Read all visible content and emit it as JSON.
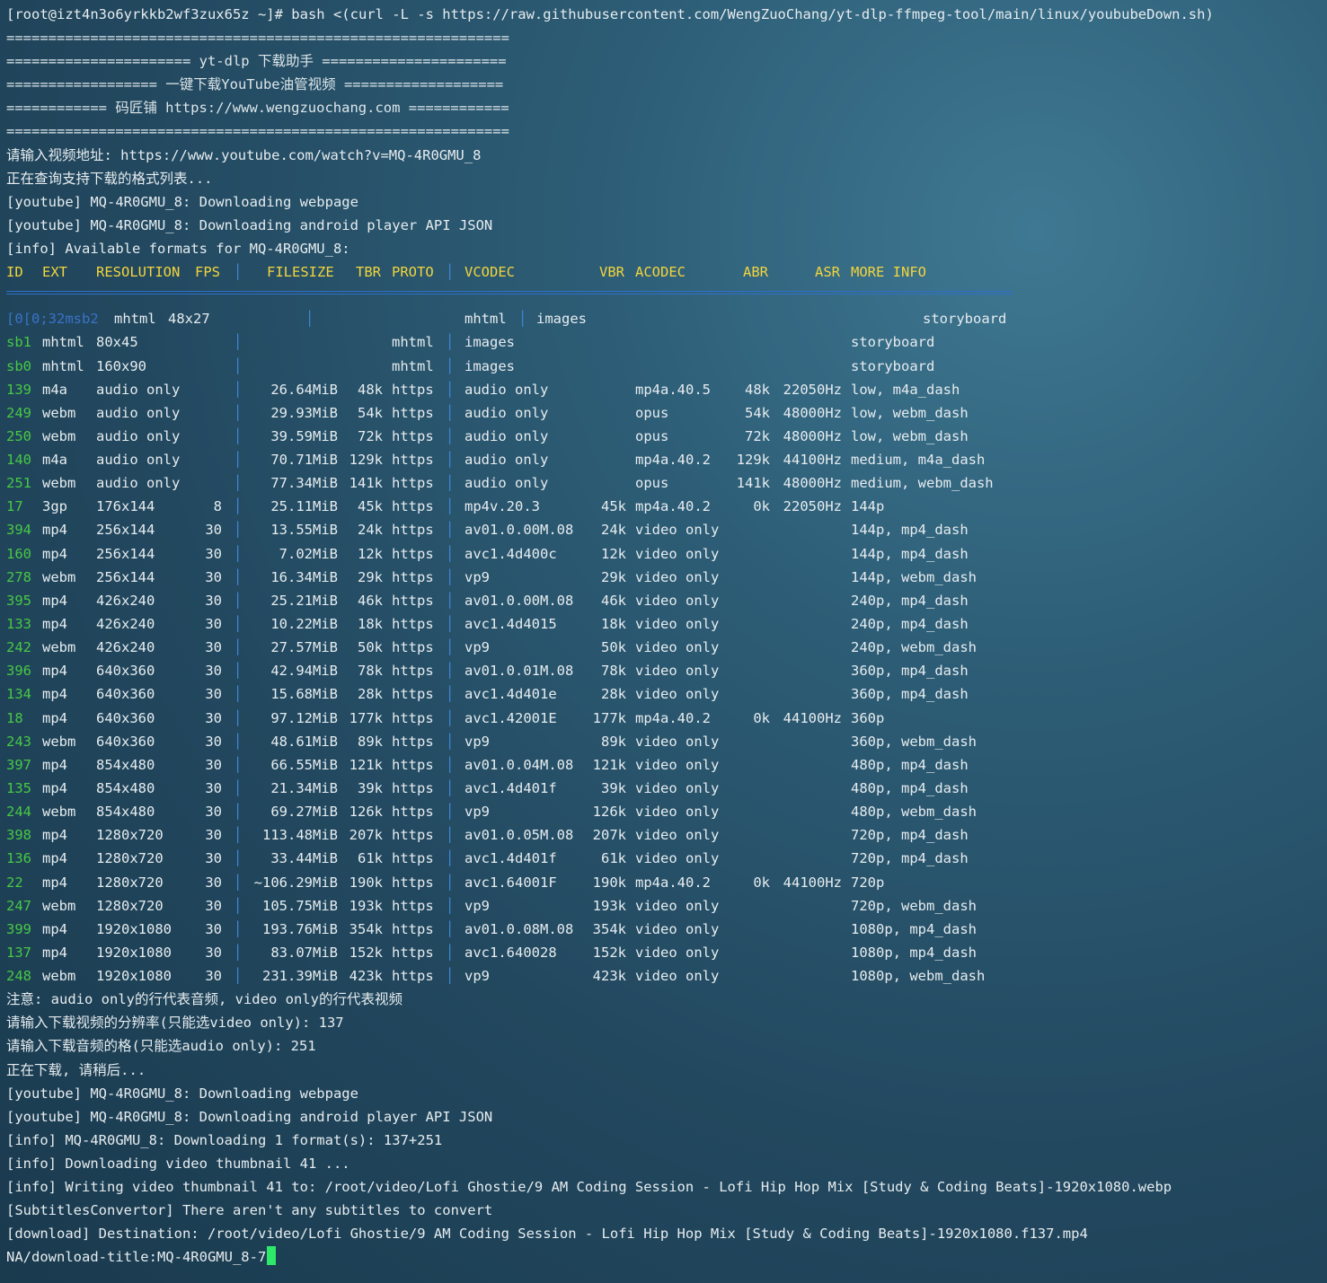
{
  "command": {
    "prompt": "[root@izt4n3o6yrkkb2wf3zux65z ~]#",
    "text": "bash <(curl -L -s https://raw.githubusercontent.com/WengZuoChang/yt-dlp-ffmpeg-tool/main/linux/yoububeDown.sh)"
  },
  "banner": [
    "============================================================",
    "====================== yt-dlp 下载助手 ======================",
    "================== 一键下载YouTube油管视频 ===================",
    "============ 码匠铺 https://www.wengzuochang.com ============",
    "============================================================"
  ],
  "pre_lines": [
    "请输入视频地址: https://www.youtube.com/watch?v=MQ-4R0GMU_8",
    "正在查询支持下载的格式列表...",
    "[youtube] MQ-4R0GMU_8: Downloading webpage",
    "[youtube] MQ-4R0GMU_8: Downloading android player API JSON",
    "[info] Available formats for MQ-4R0GMU_8:"
  ],
  "table_header": {
    "id": "ID",
    "ext": "EXT",
    "resolution": "RESOLUTION",
    "fps": "FPS",
    "filesize": "FILESIZE",
    "tbr": "TBR",
    "proto": "PROTO",
    "vcodec": "VCODEC",
    "vbr": "VBR",
    "acodec": "ACODEC",
    "abr": "ABR",
    "asr": "ASR",
    "more": "MORE INFO"
  },
  "first_row": {
    "id": "[0[0;32msb2",
    "ext": "mhtml",
    "resolution": "48x27",
    "vcodec": "mhtml",
    "acodec": "images",
    "more": "storyboard"
  },
  "formats": [
    {
      "id": "sb1",
      "ext": "mhtml",
      "res": "80x45",
      "fps": "",
      "size": "",
      "tbr": "",
      "proto": "mhtml",
      "vcodec": "images",
      "vbr": "",
      "acodec": "",
      "abr": "",
      "asr": "",
      "more": "storyboard"
    },
    {
      "id": "sb0",
      "ext": "mhtml",
      "res": "160x90",
      "fps": "",
      "size": "",
      "tbr": "",
      "proto": "mhtml",
      "vcodec": "images",
      "vbr": "",
      "acodec": "",
      "abr": "",
      "asr": "",
      "more": "storyboard"
    },
    {
      "id": "139",
      "ext": "m4a",
      "res": "audio only",
      "fps": "",
      "size": "26.64MiB",
      "tbr": "48k",
      "proto": "https",
      "vcodec": "audio only",
      "vbr": "",
      "acodec": "mp4a.40.5",
      "abr": "48k",
      "asr": "22050Hz",
      "more": "low, m4a_dash"
    },
    {
      "id": "249",
      "ext": "webm",
      "res": "audio only",
      "fps": "",
      "size": "29.93MiB",
      "tbr": "54k",
      "proto": "https",
      "vcodec": "audio only",
      "vbr": "",
      "acodec": "opus",
      "abr": "54k",
      "asr": "48000Hz",
      "more": "low, webm_dash"
    },
    {
      "id": "250",
      "ext": "webm",
      "res": "audio only",
      "fps": "",
      "size": "39.59MiB",
      "tbr": "72k",
      "proto": "https",
      "vcodec": "audio only",
      "vbr": "",
      "acodec": "opus",
      "abr": "72k",
      "asr": "48000Hz",
      "more": "low, webm_dash"
    },
    {
      "id": "140",
      "ext": "m4a",
      "res": "audio only",
      "fps": "",
      "size": "70.71MiB",
      "tbr": "129k",
      "proto": "https",
      "vcodec": "audio only",
      "vbr": "",
      "acodec": "mp4a.40.2",
      "abr": "129k",
      "asr": "44100Hz",
      "more": "medium, m4a_dash"
    },
    {
      "id": "251",
      "ext": "webm",
      "res": "audio only",
      "fps": "",
      "size": "77.34MiB",
      "tbr": "141k",
      "proto": "https",
      "vcodec": "audio only",
      "vbr": "",
      "acodec": "opus",
      "abr": "141k",
      "asr": "48000Hz",
      "more": "medium, webm_dash"
    },
    {
      "id": "17",
      "ext": "3gp",
      "res": "176x144",
      "fps": "8",
      "size": "25.11MiB",
      "tbr": "45k",
      "proto": "https",
      "vcodec": "mp4v.20.3",
      "vbr": "45k",
      "acodec": "mp4a.40.2",
      "abr": "0k",
      "asr": "22050Hz",
      "more": "144p"
    },
    {
      "id": "394",
      "ext": "mp4",
      "res": "256x144",
      "fps": "30",
      "size": "13.55MiB",
      "tbr": "24k",
      "proto": "https",
      "vcodec": "av01.0.00M.08",
      "vbr": "24k",
      "acodec": "video only",
      "abr": "",
      "asr": "",
      "more": "144p, mp4_dash"
    },
    {
      "id": "160",
      "ext": "mp4",
      "res": "256x144",
      "fps": "30",
      "size": "7.02MiB",
      "tbr": "12k",
      "proto": "https",
      "vcodec": "avc1.4d400c",
      "vbr": "12k",
      "acodec": "video only",
      "abr": "",
      "asr": "",
      "more": "144p, mp4_dash"
    },
    {
      "id": "278",
      "ext": "webm",
      "res": "256x144",
      "fps": "30",
      "size": "16.34MiB",
      "tbr": "29k",
      "proto": "https",
      "vcodec": "vp9",
      "vbr": "29k",
      "acodec": "video only",
      "abr": "",
      "asr": "",
      "more": "144p, webm_dash"
    },
    {
      "id": "395",
      "ext": "mp4",
      "res": "426x240",
      "fps": "30",
      "size": "25.21MiB",
      "tbr": "46k",
      "proto": "https",
      "vcodec": "av01.0.00M.08",
      "vbr": "46k",
      "acodec": "video only",
      "abr": "",
      "asr": "",
      "more": "240p, mp4_dash"
    },
    {
      "id": "133",
      "ext": "mp4",
      "res": "426x240",
      "fps": "30",
      "size": "10.22MiB",
      "tbr": "18k",
      "proto": "https",
      "vcodec": "avc1.4d4015",
      "vbr": "18k",
      "acodec": "video only",
      "abr": "",
      "asr": "",
      "more": "240p, mp4_dash"
    },
    {
      "id": "242",
      "ext": "webm",
      "res": "426x240",
      "fps": "30",
      "size": "27.57MiB",
      "tbr": "50k",
      "proto": "https",
      "vcodec": "vp9",
      "vbr": "50k",
      "acodec": "video only",
      "abr": "",
      "asr": "",
      "more": "240p, webm_dash"
    },
    {
      "id": "396",
      "ext": "mp4",
      "res": "640x360",
      "fps": "30",
      "size": "42.94MiB",
      "tbr": "78k",
      "proto": "https",
      "vcodec": "av01.0.01M.08",
      "vbr": "78k",
      "acodec": "video only",
      "abr": "",
      "asr": "",
      "more": "360p, mp4_dash"
    },
    {
      "id": "134",
      "ext": "mp4",
      "res": "640x360",
      "fps": "30",
      "size": "15.68MiB",
      "tbr": "28k",
      "proto": "https",
      "vcodec": "avc1.4d401e",
      "vbr": "28k",
      "acodec": "video only",
      "abr": "",
      "asr": "",
      "more": "360p, mp4_dash"
    },
    {
      "id": "18",
      "ext": "mp4",
      "res": "640x360",
      "fps": "30",
      "size": "97.12MiB",
      "tbr": "177k",
      "proto": "https",
      "vcodec": "avc1.42001E",
      "vbr": "177k",
      "acodec": "mp4a.40.2",
      "abr": "0k",
      "asr": "44100Hz",
      "more": "360p"
    },
    {
      "id": "243",
      "ext": "webm",
      "res": "640x360",
      "fps": "30",
      "size": "48.61MiB",
      "tbr": "89k",
      "proto": "https",
      "vcodec": "vp9",
      "vbr": "89k",
      "acodec": "video only",
      "abr": "",
      "asr": "",
      "more": "360p, webm_dash"
    },
    {
      "id": "397",
      "ext": "mp4",
      "res": "854x480",
      "fps": "30",
      "size": "66.55MiB",
      "tbr": "121k",
      "proto": "https",
      "vcodec": "av01.0.04M.08",
      "vbr": "121k",
      "acodec": "video only",
      "abr": "",
      "asr": "",
      "more": "480p, mp4_dash"
    },
    {
      "id": "135",
      "ext": "mp4",
      "res": "854x480",
      "fps": "30",
      "size": "21.34MiB",
      "tbr": "39k",
      "proto": "https",
      "vcodec": "avc1.4d401f",
      "vbr": "39k",
      "acodec": "video only",
      "abr": "",
      "asr": "",
      "more": "480p, mp4_dash"
    },
    {
      "id": "244",
      "ext": "webm",
      "res": "854x480",
      "fps": "30",
      "size": "69.27MiB",
      "tbr": "126k",
      "proto": "https",
      "vcodec": "vp9",
      "vbr": "126k",
      "acodec": "video only",
      "abr": "",
      "asr": "",
      "more": "480p, webm_dash"
    },
    {
      "id": "398",
      "ext": "mp4",
      "res": "1280x720",
      "fps": "30",
      "size": "113.48MiB",
      "tbr": "207k",
      "proto": "https",
      "vcodec": "av01.0.05M.08",
      "vbr": "207k",
      "acodec": "video only",
      "abr": "",
      "asr": "",
      "more": "720p, mp4_dash"
    },
    {
      "id": "136",
      "ext": "mp4",
      "res": "1280x720",
      "fps": "30",
      "size": "33.44MiB",
      "tbr": "61k",
      "proto": "https",
      "vcodec": "avc1.4d401f",
      "vbr": "61k",
      "acodec": "video only",
      "abr": "",
      "asr": "",
      "more": "720p, mp4_dash"
    },
    {
      "id": "22",
      "ext": "mp4",
      "res": "1280x720",
      "fps": "30",
      "size": "~106.29MiB",
      "tbr": "190k",
      "proto": "https",
      "vcodec": "avc1.64001F",
      "vbr": "190k",
      "acodec": "mp4a.40.2",
      "abr": "0k",
      "asr": "44100Hz",
      "more": "720p"
    },
    {
      "id": "247",
      "ext": "webm",
      "res": "1280x720",
      "fps": "30",
      "size": "105.75MiB",
      "tbr": "193k",
      "proto": "https",
      "vcodec": "vp9",
      "vbr": "193k",
      "acodec": "video only",
      "abr": "",
      "asr": "",
      "more": "720p, webm_dash"
    },
    {
      "id": "399",
      "ext": "mp4",
      "res": "1920x1080",
      "fps": "30",
      "size": "193.76MiB",
      "tbr": "354k",
      "proto": "https",
      "vcodec": "av01.0.08M.08",
      "vbr": "354k",
      "acodec": "video only",
      "abr": "",
      "asr": "",
      "more": "1080p, mp4_dash"
    },
    {
      "id": "137",
      "ext": "mp4",
      "res": "1920x1080",
      "fps": "30",
      "size": "83.07MiB",
      "tbr": "152k",
      "proto": "https",
      "vcodec": "avc1.640028",
      "vbr": "152k",
      "acodec": "video only",
      "abr": "",
      "asr": "",
      "more": "1080p, mp4_dash"
    },
    {
      "id": "248",
      "ext": "webm",
      "res": "1920x1080",
      "fps": "30",
      "size": "231.39MiB",
      "tbr": "423k",
      "proto": "https",
      "vcodec": "vp9",
      "vbr": "423k",
      "acodec": "video only",
      "abr": "",
      "asr": "",
      "more": "1080p, webm_dash"
    }
  ],
  "post_lines": [
    "注意: audio only的行代表音频, video only的行代表视频",
    "请输入下载视频的分辨率(只能选video only): 137",
    "请输入下载音频的格(只能选audio only): 251",
    "正在下载, 请稍后...",
    "[youtube] MQ-4R0GMU_8: Downloading webpage",
    "[youtube] MQ-4R0GMU_8: Downloading android player API JSON",
    "[info] MQ-4R0GMU_8: Downloading 1 format(s): 137+251",
    "[info] Downloading video thumbnail 41 ...",
    "[info] Writing video thumbnail 41 to: /root/video/Lofi Ghostie/9 AM Coding Session - Lofi Hip Hop Mix [Study & Coding Beats]-1920x1080.webp",
    "[SubtitlesConvertor] There aren't any subtitles to convert",
    "[download] Destination: /root/video/Lofi Ghostie/9 AM Coding Session - Lofi Hip Hop Mix [Study & Coding Beats]-1920x1080.f137.mp4"
  ],
  "last_line": "NA/download-title:MQ-4R0GMU_8-7",
  "colors": {
    "header": "#f2d53c",
    "format_id": "#47c845",
    "pipe": "#3f86d6",
    "cursor": "#2ee86a"
  }
}
